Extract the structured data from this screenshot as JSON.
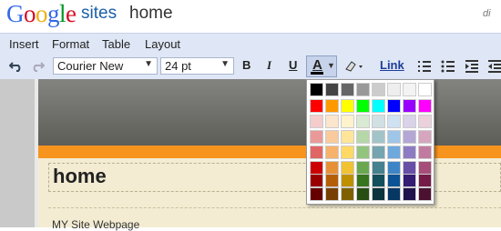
{
  "header": {
    "logo": "Google",
    "product": "sites",
    "page_name": "home",
    "user": "di"
  },
  "menu": [
    "Insert",
    "Format",
    "Table",
    "Layout"
  ],
  "toolbar": {
    "font": "Courier New",
    "size": "24 pt",
    "bold": "B",
    "italic": "I",
    "underline": "U",
    "text_color": "A",
    "link": "Link"
  },
  "page": {
    "title": "home",
    "body_text": "MY Site Webpage"
  },
  "colors": {
    "logo": [
      "#3369e8",
      "#d50f25",
      "#eeb211",
      "#3369e8",
      "#009925",
      "#d50f25"
    ],
    "palette": [
      [
        "#000000",
        "#444444",
        "#666666",
        "#999999",
        "#cccccc",
        "#eeeeee",
        "#f3f3f3",
        "#ffffff"
      ],
      [
        "#ff0000",
        "#ff9900",
        "#ffff00",
        "#00ff00",
        "#00ffff",
        "#0000ff",
        "#9900ff",
        "#ff00ff"
      ],
      [
        "#f4cccc",
        "#fce5cd",
        "#fff2cc",
        "#d9ead3",
        "#d0e0e3",
        "#cfe2f3",
        "#d9d2e9",
        "#ead1dc"
      ],
      [
        "#ea9999",
        "#f9cb9c",
        "#ffe599",
        "#b6d7a8",
        "#a2c4c9",
        "#9fc5e8",
        "#b4a7d6",
        "#d5a6bd"
      ],
      [
        "#e06666",
        "#f6b26b",
        "#ffd966",
        "#93c47d",
        "#76a5af",
        "#6fa8dc",
        "#8e7cc3",
        "#c27ba0"
      ],
      [
        "#cc0000",
        "#e69138",
        "#f1c232",
        "#6aa84f",
        "#45818e",
        "#3d85c6",
        "#674ea7",
        "#a64d79"
      ],
      [
        "#990000",
        "#b45f06",
        "#bf9000",
        "#38761d",
        "#134f5c",
        "#0b5394",
        "#351c75",
        "#741b47"
      ],
      [
        "#660000",
        "#783f04",
        "#7f6000",
        "#274e13",
        "#0c343d",
        "#073763",
        "#20124d",
        "#4c1130"
      ]
    ]
  }
}
